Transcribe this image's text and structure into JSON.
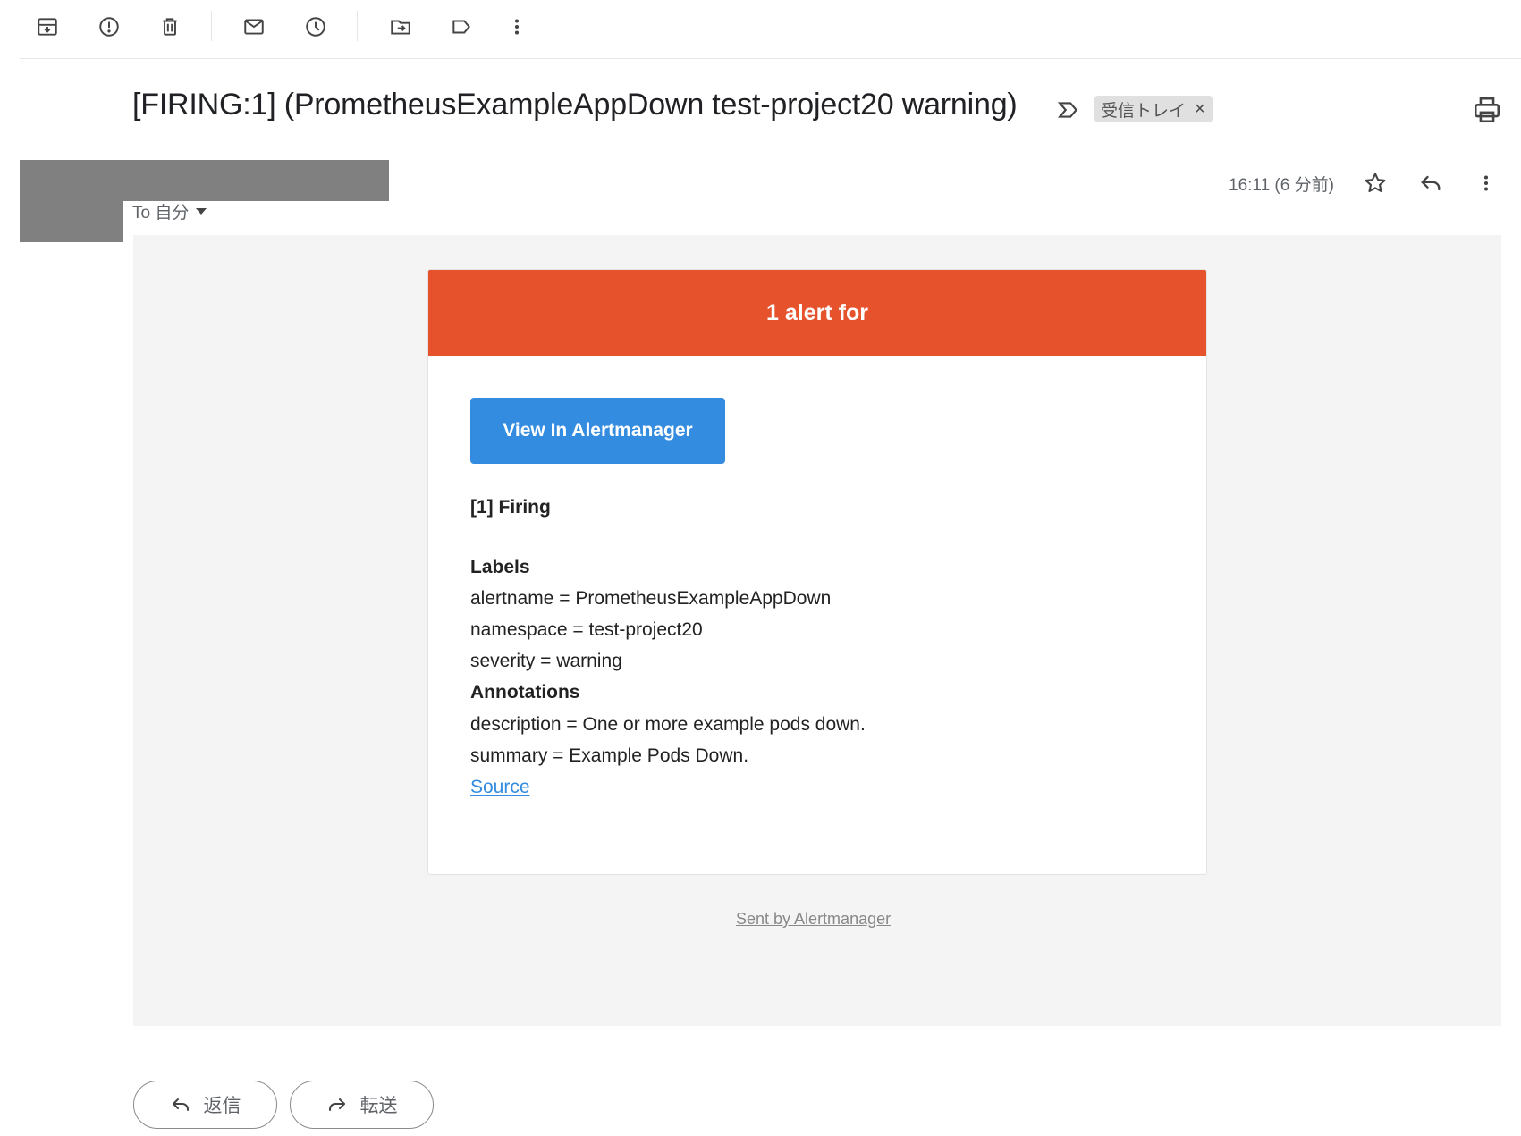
{
  "toolbar": {
    "icons": [
      "archive-icon",
      "report-spam-icon",
      "delete-icon",
      "mark-unread-icon",
      "snooze-icon",
      "move-to-icon",
      "label-icon",
      "more-vert-icon"
    ]
  },
  "email": {
    "subject": "[FIRING:1] (PrometheusExampleAppDown test-project20 warning)",
    "label": "受信トレイ",
    "label_remove": "×",
    "to_label": "To 自分",
    "time": "16:11 (6 分前)"
  },
  "card": {
    "banner_title": "1 alert for",
    "button_label": "View In Alertmanager",
    "firing_heading": "[1] Firing",
    "labels_heading": "Labels",
    "labels": [
      "alertname = PrometheusExampleAppDown",
      "namespace = test-project20",
      "severity = warning"
    ],
    "annotations_heading": "Annotations",
    "annotations": [
      "description = One or more example pods down.",
      "summary = Example Pods Down."
    ],
    "source_link": "Source",
    "sent_by": "Sent by Alertmanager"
  },
  "actions": {
    "reply_label": "返信",
    "forward_label": "転送"
  },
  "colors": {
    "banner": "#e6522c",
    "button": "#348ce0",
    "mail_background": "#f4f4f4",
    "redaction": "#808080"
  }
}
